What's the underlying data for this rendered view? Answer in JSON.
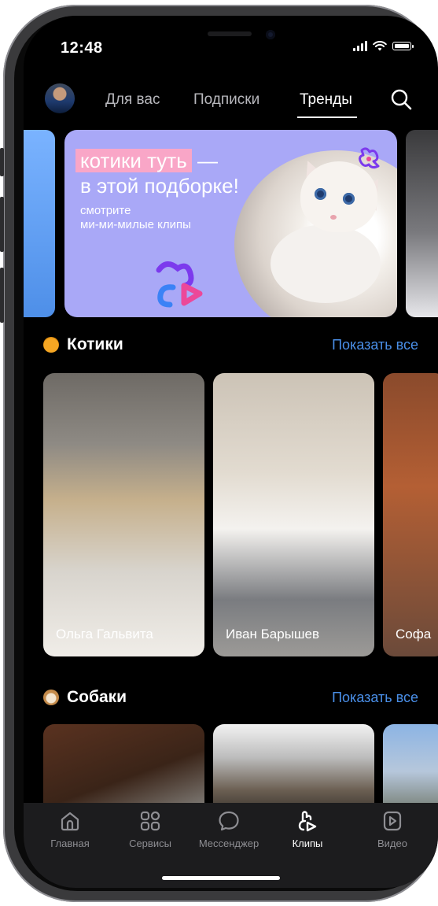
{
  "status_bar": {
    "time": "12:48"
  },
  "top_nav": {
    "tabs": [
      {
        "label": "Для вас",
        "active": false
      },
      {
        "label": "Подписки",
        "active": false
      },
      {
        "label": "Тренды",
        "active": true
      }
    ]
  },
  "banner": {
    "highlight_text": "котики туть",
    "title_line1_rest": " —",
    "title_line2": "в этой подборке!",
    "subtitle_line1": "смотрите",
    "subtitle_line2": "ми-ми-милые клипы"
  },
  "sections": [
    {
      "emoji_icon": "heart-eyes-cat-emoji",
      "title": "Котики",
      "show_all": "Показать все",
      "clips": [
        {
          "author": "Ольга Гальвита"
        },
        {
          "author": "Иван Барышев"
        },
        {
          "author": "Софа"
        }
      ]
    },
    {
      "emoji_icon": "dog-face-emoji",
      "title": "Собаки",
      "show_all": "Показать все",
      "clips": []
    }
  ],
  "tab_bar": {
    "items": [
      {
        "label": "Главная",
        "icon": "home-icon",
        "active": false
      },
      {
        "label": "Сервисы",
        "icon": "services-icon",
        "active": false
      },
      {
        "label": "Мессенджер",
        "icon": "messenger-icon",
        "active": false
      },
      {
        "label": "Клипы",
        "icon": "clips-icon",
        "active": true
      },
      {
        "label": "Видео",
        "icon": "video-icon",
        "active": false
      }
    ]
  },
  "colors": {
    "accent": "#4a8fe8",
    "banner_bg": "#a9a8f7",
    "highlight": "#f9a6c7"
  }
}
